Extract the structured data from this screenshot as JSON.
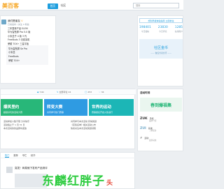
{
  "header": {
    "logo_part1": "美百客",
    "nav": [
      {
        "label": "首页"
      },
      {
        "label": "社区"
      }
    ],
    "search_placeholder": "搜索"
  },
  "profile": {
    "name": "我们是朋友",
    "badge": "V",
    "sub": "日常发布 / 关注 9 粉丝",
    "lines": [
      "三年整体产品 ELEM",
      "华为智慧屏 Pro 5.0 版",
      "小米盒子 4 版 3 代",
      "FreeBuds 3 无线耳机",
      "荣耀 70X+ 三星平板"
    ],
    "tags": [
      "华为智慧屏 Se Pro",
      "小米盒",
      "FreeBuds",
      "荣耀 70X+"
    ]
  },
  "stats": {
    "link": "想到早报体验指南 立即前往",
    "cols": [
      {
        "num": "198401",
        "label": "今日发帖"
      },
      {
        "num": "23830",
        "label": "今日评论"
      },
      {
        "num": "1285",
        "label": "在线用户"
      }
    ],
    "banner_title": "社区金币",
    "banner_sub": "—— 做任务领金币 ——"
  },
  "tiles_header": {
    "stats": [
      {
        "icon": "◆",
        "value": "7.6k"
      },
      {
        "icon": "✎",
        "value": "全部评论 24"
      },
      {
        "icon": "◯",
        "value": "253"
      },
      {
        "icon": "♡",
        "value": "34"
      }
    ]
  },
  "tiles": [
    {
      "title": "爆笑里约",
      "sub": "超级好玩的活动大赛"
    },
    {
      "title": "转变大赛",
      "sub": "共同参与热门赛事"
    },
    {
      "title": "世界的运动",
      "sub": "赛事报名开启火热进行"
    }
  ],
  "tile_desc_left": [
    "活动参加人数不限 分享快乐",
    "活动截止于 1 月 31 日",
    "本次活动的奖品即将发放"
  ],
  "tile_desc_right": [
    "共同参与本次活动 获得奖励",
    "《获奖名单》相关活动公布",
    "快来关注本次活动奖励领取"
  ],
  "right_panel": {
    "title": "活动时间",
    "banner": "春到爆福集",
    "brands": [
      {
        "name": "ZUK",
        "desc": "手机",
        "sub": "品牌介绍"
      },
      {
        "name": "ZUI",
        "desc": "系统",
        "sub": "了解更多"
      },
      {
        "name": "⚡",
        "desc": "活动",
        "sub": "最新动态"
      }
    ]
  },
  "list": {
    "tabs": [
      "热门",
      "推荐",
      "专栏",
      "精华"
    ],
    "article_title": "突发！网易就下发布产品测评"
  },
  "watermark": {
    "main": "东麟红胖子",
    "small": "头"
  }
}
